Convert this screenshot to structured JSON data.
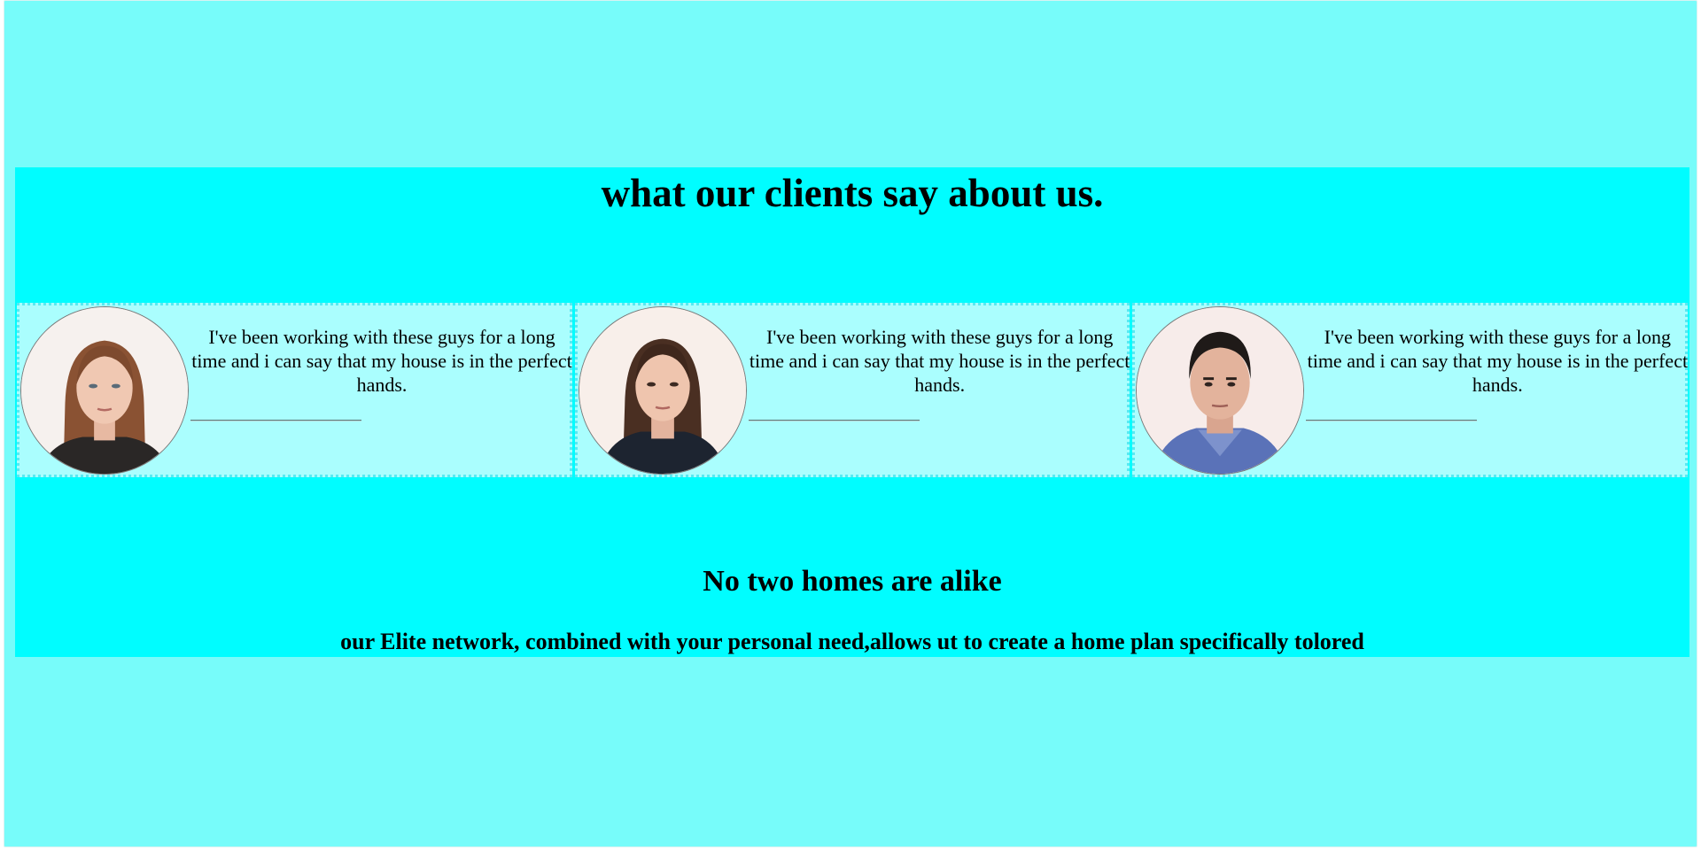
{
  "testimonials": {
    "heading": "what our clients say about us.",
    "items": [
      {
        "quote": "I've been working with these guys for a long time and i can say that my house is in the perfect hands.",
        "photo_icon": "woman-portrait-icon"
      },
      {
        "quote": "I've been working with these guys for a long time and i can say that my house is in the perfect hands.",
        "photo_icon": "woman-portrait-icon"
      },
      {
        "quote": "I've been working with these guys for a long time and i can say that my house is in the perfect hands.",
        "photo_icon": "man-portrait-icon"
      }
    ]
  },
  "promo": {
    "heading": "No two homes are alike",
    "tagline": "our Elite network, combined with your personal need,allows ut to create a home plan specifically tolored"
  },
  "colors": {
    "page_background": "#77fcfa",
    "band_background": "#00fdff",
    "card_background": "#aafefe",
    "card_border": "#58e9f2"
  }
}
